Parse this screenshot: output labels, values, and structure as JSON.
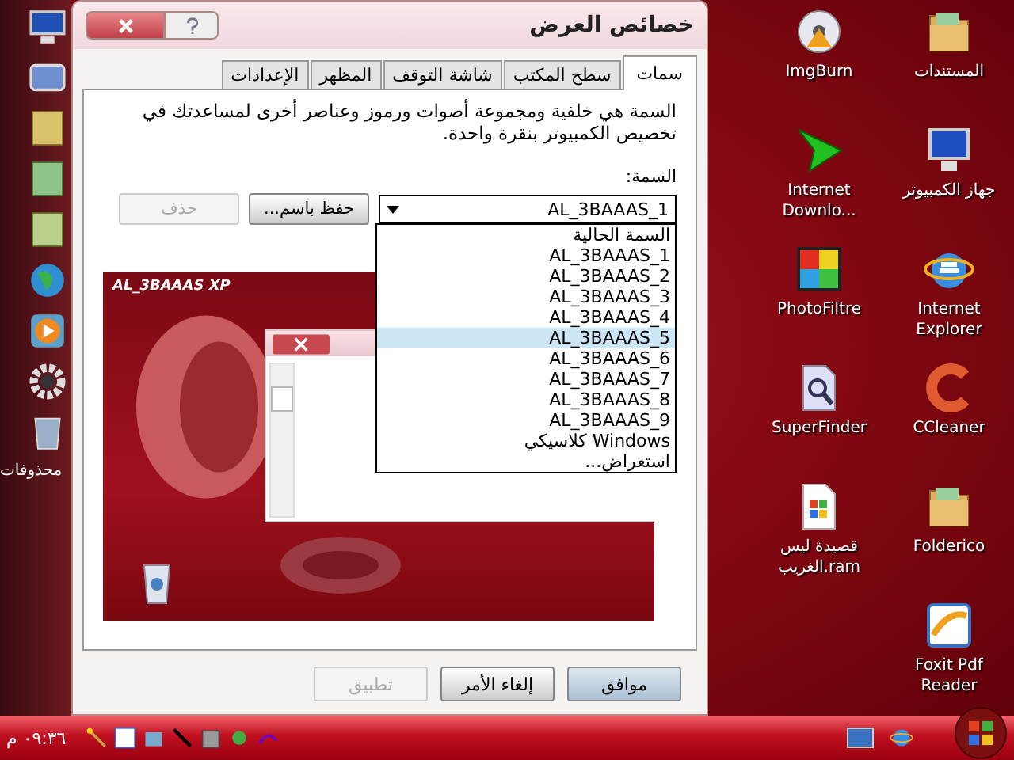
{
  "dialog": {
    "title": "خصائص العرض",
    "tabs": [
      {
        "label": "سمات",
        "selected": true
      },
      {
        "label": "سطح المكتب",
        "selected": false
      },
      {
        "label": "شاشة التوقف",
        "selected": false
      },
      {
        "label": "المظهر",
        "selected": false
      },
      {
        "label": "الإعدادات",
        "selected": false
      }
    ],
    "description": "السمة هي خلفية ومجموعة أصوات ورموز وعناصر أخرى لمساعدتك في تخصيص الكمبيوتر بنقرة واحدة.",
    "theme_label": "السمة:",
    "theme_select": {
      "value": "AL_3BAAAS_1",
      "expanded": true
    },
    "save_button": {
      "label": "حفظ باسم...",
      "disabled": false
    },
    "delete_button": {
      "label": "حذف",
      "disabled": true
    },
    "theme_options": [
      {
        "label": "السمة الحالية",
        "selected": false
      },
      {
        "label": "AL_3BAAAS_1",
        "selected": false
      },
      {
        "label": "AL_3BAAAS_2",
        "selected": false
      },
      {
        "label": "AL_3BAAAS_3",
        "selected": false
      },
      {
        "label": "AL_3BAAAS_4",
        "selected": false
      },
      {
        "label": "AL_3BAAAS_5",
        "selected": true
      },
      {
        "label": "AL_3BAAAS_6",
        "selected": false
      },
      {
        "label": "AL_3BAAAS_7",
        "selected": false
      },
      {
        "label": "AL_3BAAAS_8",
        "selected": false
      },
      {
        "label": "AL_3BAAAS_9",
        "selected": false
      },
      {
        "label": "Windows كلاسيكي",
        "selected": false
      },
      {
        "label": "استعراض...",
        "selected": false
      }
    ],
    "preview": {
      "caption": "AL_3BAAAS XP"
    },
    "buttons": [
      {
        "label": "موافق",
        "disabled": false
      },
      {
        "label": "إلغاء الأمر",
        "disabled": false
      },
      {
        "label": "تطبيق",
        "disabled": true
      }
    ]
  },
  "desktop_columns": [
    [
      {
        "label": "المستندات",
        "kind": "folder"
      },
      {
        "label": "جهاز الكمبيوتر",
        "kind": "monitor"
      },
      {
        "label": "Internet Explorer",
        "kind": "browser"
      },
      {
        "label": "CCleaner",
        "kind": "cleaner"
      },
      {
        "label": "Folderico",
        "kind": "folder"
      },
      {
        "label": "Foxit Pdf Reader",
        "kind": "pdf"
      }
    ],
    [
      {
        "label": "ImgBurn",
        "kind": "disc"
      },
      {
        "label": "Internet Downlo...",
        "kind": "arrow"
      },
      {
        "label": "PhotoFiltre",
        "kind": "puzzle"
      },
      {
        "label": "SuperFinder",
        "kind": "search"
      },
      {
        "label": "قصيدة ليس الغريب.ram",
        "kind": "document"
      }
    ]
  ],
  "dock": {
    "label": "محذوفات"
  },
  "taskbar": {
    "clock": "٠٩:٣٦ م"
  }
}
